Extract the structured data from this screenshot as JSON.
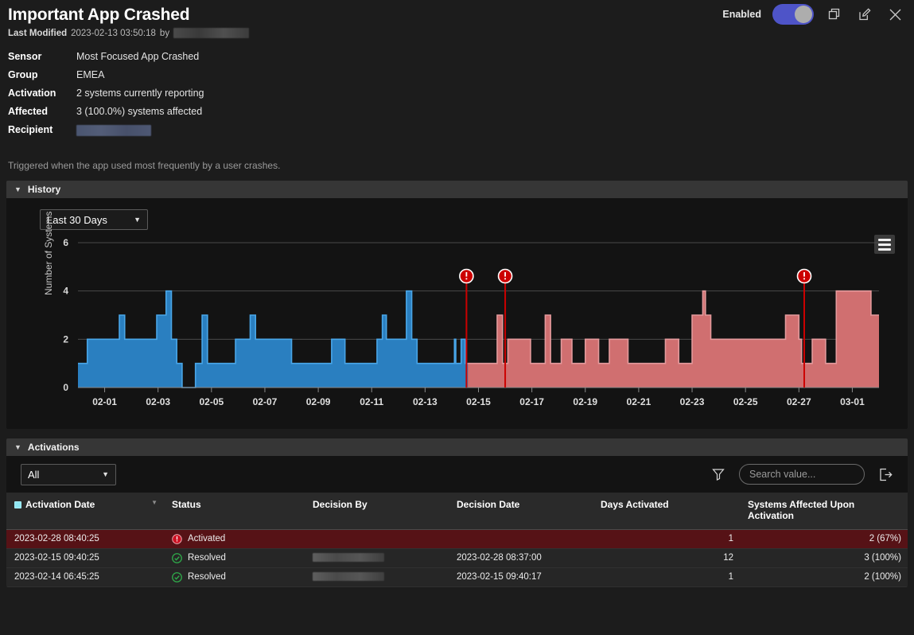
{
  "header": {
    "title": "Important App Crashed",
    "last_modified_label": "Last Modified",
    "last_modified_value": "2023-02-13 03:50:18",
    "by_label": "by",
    "enabled_label": "Enabled",
    "toggle_state": "on",
    "icons": [
      "copy-icon",
      "edit-icon",
      "close-icon"
    ],
    "accent_toggle_color": "#4e54c8"
  },
  "meta": {
    "rows": [
      {
        "key": "Sensor",
        "value": "Most Focused App Crashed"
      },
      {
        "key": "Group",
        "value": "EMEA"
      },
      {
        "key": "Activation",
        "value": "2 systems currently reporting"
      },
      {
        "key": "Affected",
        "value": "3 (100.0%) systems affected"
      },
      {
        "key": "Recipient",
        "value": ""
      }
    ],
    "description": "Triggered when the app used most frequently by a user crashes."
  },
  "history": {
    "panel_title": "History",
    "range_value": "Last 30 Days",
    "menu_icon": "hamburger-menu-icon"
  },
  "activations": {
    "panel_title": "Activations",
    "filter_value": "All",
    "filter_icon": "funnel-icon",
    "export_icon": "export-icon",
    "search_placeholder": "Search value...",
    "search_value": "",
    "columns": [
      "Activation Date",
      "Status",
      "Decision By",
      "Decision Date",
      "Days Activated",
      "Systems Affected Upon Activation"
    ],
    "rows": [
      {
        "activation_date": "2023-02-28 08:40:25",
        "status": "Activated",
        "status_icon": "alert-circle-icon",
        "decision_by": "",
        "decision_date": "",
        "days_activated": "1",
        "systems_affected": "2 (67%)",
        "highlight": true
      },
      {
        "activation_date": "2023-02-15 09:40:25",
        "status": "Resolved",
        "status_icon": "check-circle-icon",
        "decision_by": "",
        "decision_date": "2023-02-28 08:37:00",
        "days_activated": "12",
        "systems_affected": "3 (100%)",
        "highlight": false
      },
      {
        "activation_date": "2023-02-14 06:45:25",
        "status": "Resolved",
        "status_icon": "check-circle-icon",
        "decision_by": "",
        "decision_date": "2023-02-15 09:40:17",
        "days_activated": "1",
        "systems_affected": "2 (100%)",
        "highlight": false
      }
    ]
  },
  "chart_data": {
    "type": "area",
    "title": "",
    "xlabel": "",
    "ylabel": "Number of Systems",
    "ylim": [
      0,
      6
    ],
    "yticks": [
      0,
      2,
      4,
      6
    ],
    "xticks": [
      "02-01",
      "02-03",
      "02-05",
      "02-07",
      "02-09",
      "02-11",
      "02-13",
      "02-15",
      "02-17",
      "02-19",
      "02-21",
      "02-23",
      "02-25",
      "02-27",
      "03-01"
    ],
    "grid": true,
    "legend": "none",
    "colors": {
      "before": "#2a7fc0",
      "after": "#d06f70",
      "marker": "#cc0000"
    },
    "split_x": 14.6,
    "x_start": 0,
    "x_end": 30,
    "markers": [
      {
        "x": 14.55,
        "label": "alert-marker"
      },
      {
        "x": 16.0,
        "label": "alert-marker"
      },
      {
        "x": 27.2,
        "label": "alert-marker"
      }
    ],
    "series": [
      {
        "name": "Number of Systems",
        "points": [
          [
            0.0,
            1
          ],
          [
            0.35,
            2
          ],
          [
            1.5,
            2
          ],
          [
            1.55,
            3
          ],
          [
            1.7,
            3
          ],
          [
            1.75,
            2
          ],
          [
            2.9,
            2
          ],
          [
            2.95,
            3
          ],
          [
            3.2,
            3
          ],
          [
            3.3,
            4
          ],
          [
            3.4,
            4
          ],
          [
            3.5,
            2
          ],
          [
            3.7,
            1
          ],
          [
            3.9,
            0
          ],
          [
            4.3,
            0
          ],
          [
            4.4,
            1
          ],
          [
            4.6,
            1
          ],
          [
            4.65,
            3
          ],
          [
            4.8,
            3
          ],
          [
            4.85,
            1
          ],
          [
            5.8,
            1
          ],
          [
            5.9,
            2
          ],
          [
            6.4,
            2
          ],
          [
            6.45,
            3
          ],
          [
            6.6,
            3
          ],
          [
            6.65,
            2
          ],
          [
            7.9,
            2
          ],
          [
            8.0,
            1
          ],
          [
            9.4,
            1
          ],
          [
            9.5,
            2
          ],
          [
            9.9,
            2
          ],
          [
            10.0,
            1
          ],
          [
            11.1,
            1
          ],
          [
            11.2,
            2
          ],
          [
            11.3,
            2
          ],
          [
            11.4,
            3
          ],
          [
            11.5,
            3
          ],
          [
            11.55,
            2
          ],
          [
            12.2,
            2
          ],
          [
            12.3,
            4
          ],
          [
            12.45,
            4
          ],
          [
            12.5,
            2
          ],
          [
            12.7,
            1
          ],
          [
            14.0,
            1
          ],
          [
            14.1,
            2
          ],
          [
            14.15,
            1
          ],
          [
            14.3,
            1
          ],
          [
            14.35,
            2
          ],
          [
            14.45,
            2
          ],
          [
            14.5,
            1
          ],
          [
            15.6,
            1
          ],
          [
            15.7,
            3
          ],
          [
            15.85,
            3
          ],
          [
            15.9,
            1
          ],
          [
            16.0,
            1
          ],
          [
            16.1,
            2
          ],
          [
            16.9,
            2
          ],
          [
            16.95,
            1
          ],
          [
            17.4,
            1
          ],
          [
            17.5,
            3
          ],
          [
            17.6,
            3
          ],
          [
            17.7,
            1
          ],
          [
            18.0,
            1
          ],
          [
            18.1,
            2
          ],
          [
            18.4,
            2
          ],
          [
            18.5,
            1
          ],
          [
            18.9,
            1
          ],
          [
            19.0,
            2
          ],
          [
            19.4,
            2
          ],
          [
            19.5,
            1
          ],
          [
            19.8,
            1
          ],
          [
            19.9,
            2
          ],
          [
            20.5,
            2
          ],
          [
            20.6,
            1
          ],
          [
            21.9,
            1
          ],
          [
            22.0,
            2
          ],
          [
            22.4,
            2
          ],
          [
            22.5,
            1
          ],
          [
            22.9,
            1
          ],
          [
            23.0,
            3
          ],
          [
            23.3,
            3
          ],
          [
            23.4,
            4
          ],
          [
            23.45,
            4
          ],
          [
            23.5,
            3
          ],
          [
            23.6,
            3
          ],
          [
            23.7,
            2
          ],
          [
            26.4,
            2
          ],
          [
            26.5,
            3
          ],
          [
            26.9,
            3
          ],
          [
            27.0,
            2
          ],
          [
            27.1,
            1
          ],
          [
            27.4,
            1
          ],
          [
            27.5,
            2
          ],
          [
            27.9,
            2
          ],
          [
            28.0,
            1
          ],
          [
            28.3,
            1
          ],
          [
            28.4,
            4
          ],
          [
            29.6,
            4
          ],
          [
            29.7,
            3
          ],
          [
            30.0,
            3
          ]
        ]
      }
    ]
  }
}
